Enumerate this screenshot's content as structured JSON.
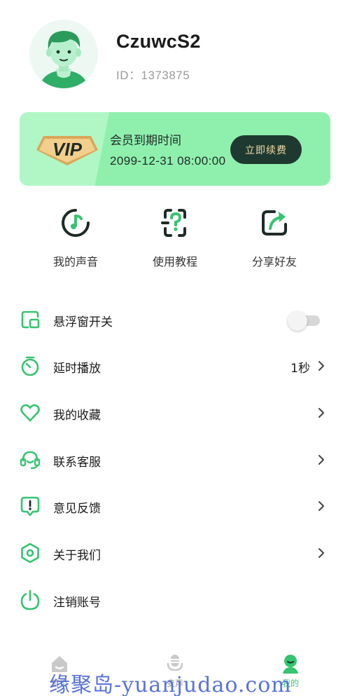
{
  "profile": {
    "username": "CzuwcS2",
    "id_text": "ID：1373875"
  },
  "vip": {
    "badge": "VIP",
    "title": "会员到期时间",
    "expire": "2099-12-31 08:00:00",
    "renew_label": "立即续费"
  },
  "quick_actions": [
    {
      "label": "我的声音",
      "icon": "my-voice-icon"
    },
    {
      "label": "使用教程",
      "icon": "tutorial-icon"
    },
    {
      "label": "分享好友",
      "icon": "share-icon"
    }
  ],
  "menu": [
    {
      "label": "悬浮窗开关",
      "icon": "floating-window-icon",
      "toggle": false
    },
    {
      "label": "延时播放",
      "icon": "timer-icon",
      "value": "1秒"
    },
    {
      "label": "我的收藏",
      "icon": "heart-icon"
    },
    {
      "label": "联系客服",
      "icon": "headset-icon"
    },
    {
      "label": "意见反馈",
      "icon": "feedback-icon"
    },
    {
      "label": "关于我们",
      "icon": "about-icon"
    },
    {
      "label": "注销账号",
      "icon": "power-icon"
    }
  ],
  "tabs": [
    {
      "label": "首页",
      "icon": "home-icon",
      "active": false
    },
    {
      "label": "变声",
      "icon": "voice-change-icon",
      "active": false
    },
    {
      "label": "我的",
      "icon": "profile-icon",
      "active": true
    }
  ],
  "watermark": "缘聚岛-yuanjudao.com",
  "colors": {
    "accent": "#35c46f",
    "vip_card": "#8ff0ae",
    "renew_button": "#1e3a30",
    "renew_text": "#f3d9a4"
  }
}
